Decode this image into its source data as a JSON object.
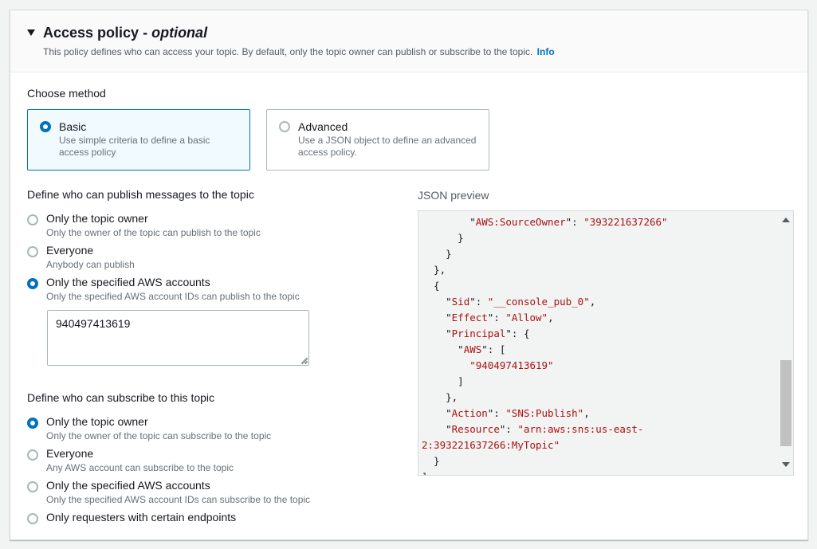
{
  "header": {
    "title": "Access policy",
    "title_sep": " - ",
    "title_optional": "optional",
    "description": "This policy defines who can access your topic. By default, only the topic owner can publish or subscribe to the topic.",
    "info_link": "Info"
  },
  "method": {
    "label": "Choose method",
    "options": [
      {
        "title": "Basic",
        "description": "Use simple criteria to define a basic access policy",
        "selected": true
      },
      {
        "title": "Advanced",
        "description": "Use a JSON object to define an advanced access policy.",
        "selected": false
      }
    ]
  },
  "publish": {
    "label": "Define who can publish messages to the topic",
    "options": [
      {
        "title": "Only the topic owner",
        "description": "Only the owner of the topic can publish to the topic",
        "selected": false
      },
      {
        "title": "Everyone",
        "description": "Anybody can publish",
        "selected": false
      },
      {
        "title": "Only the specified AWS accounts",
        "description": "Only the specified AWS account IDs can publish to the topic",
        "selected": true
      }
    ],
    "accounts_value": "940497413619"
  },
  "subscribe": {
    "label": "Define who can subscribe to this topic",
    "options": [
      {
        "title": "Only the topic owner",
        "description": "Only the owner of the topic can subscribe to the topic",
        "selected": true
      },
      {
        "title": "Everyone",
        "description": "Any AWS account can subscribe to the topic",
        "selected": false
      },
      {
        "title": "Only the specified AWS accounts",
        "description": "Only the specified AWS account IDs can subscribe to the topic",
        "selected": false
      },
      {
        "title": "Only requesters with certain endpoints",
        "description": "",
        "selected": false
      }
    ]
  },
  "json_preview": {
    "label": "JSON preview",
    "lines": [
      [
        {
          "t": "        \""
        },
        {
          "s": "AWS:SourceOwner"
        },
        {
          "t": "\": "
        },
        {
          "s": "\"393221637266\""
        }
      ],
      [
        {
          "t": "      }"
        }
      ],
      [
        {
          "t": "    }"
        }
      ],
      [
        {
          "t": "  },"
        }
      ],
      [
        {
          "t": "  {"
        }
      ],
      [
        {
          "t": "    \""
        },
        {
          "s": "Sid"
        },
        {
          "t": "\": "
        },
        {
          "s": "\"__console_pub_0\""
        },
        {
          "t": ","
        }
      ],
      [
        {
          "t": "    \""
        },
        {
          "s": "Effect"
        },
        {
          "t": "\": "
        },
        {
          "s": "\"Allow\""
        },
        {
          "t": ","
        }
      ],
      [
        {
          "t": "    \""
        },
        {
          "s": "Principal"
        },
        {
          "t": "\": {"
        }
      ],
      [
        {
          "t": "      \""
        },
        {
          "s": "AWS"
        },
        {
          "t": "\": ["
        }
      ],
      [
        {
          "t": "        "
        },
        {
          "s": "\"940497413619\""
        }
      ],
      [
        {
          "t": "      ]"
        }
      ],
      [
        {
          "t": "    },"
        }
      ],
      [
        {
          "t": "    \""
        },
        {
          "s": "Action"
        },
        {
          "t": "\": "
        },
        {
          "s": "\"SNS:Publish\""
        },
        {
          "t": ","
        }
      ],
      [
        {
          "t": "    \""
        },
        {
          "s": "Resource"
        },
        {
          "t": "\": "
        },
        {
          "s": "\"arn:aws:sns:us-east-"
        }
      ],
      [
        {
          "s": "2:393221637266:MyTopic\""
        }
      ],
      [
        {
          "t": "  }"
        }
      ],
      [
        {
          "t": "]"
        }
      ]
    ]
  }
}
